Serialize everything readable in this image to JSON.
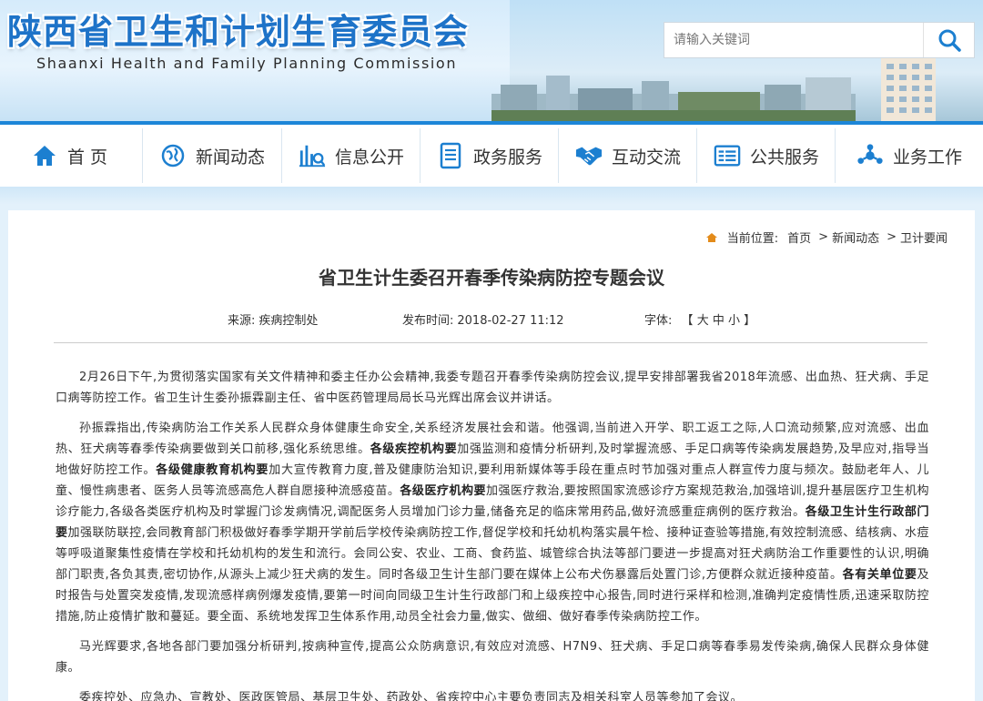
{
  "header": {
    "site_title": "陕西省卫生和计划生育委员会",
    "site_subtitle": "Shaanxi Health and Family Planning Commission",
    "search_placeholder": "请输入关键词"
  },
  "nav": {
    "items": [
      {
        "label": "首 页",
        "icon": "home-icon"
      },
      {
        "label": "新闻动态",
        "icon": "globe-icon"
      },
      {
        "label": "信息公开",
        "icon": "chart-search-icon"
      },
      {
        "label": "政务服务",
        "icon": "document-icon"
      },
      {
        "label": "互动交流",
        "icon": "handshake-icon"
      },
      {
        "label": "公共服务",
        "icon": "list-card-icon"
      },
      {
        "label": "业务工作",
        "icon": "network-icon"
      }
    ],
    "active_color": "#1c86d8"
  },
  "breadcrumb": {
    "lead": "当前位置:",
    "items": [
      "首页",
      "新闻动态",
      "卫计要闻"
    ],
    "separator": ">"
  },
  "article": {
    "title": "省卫生计生委召开春季传染病防控专题会议",
    "source_label": "来源:",
    "source_value": "疾病控制处",
    "date_label": "发布时间:",
    "date_value": "2018-02-27 11:12",
    "font_label": "字体:",
    "font_open": "【",
    "font_large": "大",
    "font_medium": "中",
    "font_small": "小",
    "font_close": "】",
    "paragraphs": [
      [
        {
          "t": "2月26日下午,为贯彻落实国家有关文件精神和委主任办公会精神,我委专题召开春季传染病防控会议,提早安排部署我省2018年流感、出血热、狂犬病、手足口病等防控工作。省卫生计生委孙振霖副主任、省中医药管理局局长马光辉出席会议并讲话。",
          "b": false
        }
      ],
      [
        {
          "t": "孙振霖指出,传染病防治工作关系人民群众身体健康生命安全,关系经济发展社会和谐。他强调,当前进入开学、职工返工之际,人口流动频繁,应对流感、出血热、狂犬病等春季传染病要做到关口前移,强化系统思维。",
          "b": false
        },
        {
          "t": "各级疾控机构要",
          "b": true
        },
        {
          "t": "加强监测和疫情分析研判,及时掌握流感、手足口病等传染病发展趋势,及早应对,指导当地做好防控工作。",
          "b": false
        },
        {
          "t": "各级健康教育机构要",
          "b": true
        },
        {
          "t": "加大宣传教育力度,普及健康防治知识,要利用新媒体等手段在重点时节加强对重点人群宣传力度与频次。鼓励老年人、儿童、慢性病患者、医务人员等流感高危人群自愿接种流感疫苗。",
          "b": false
        },
        {
          "t": "各级医疗机构要",
          "b": true
        },
        {
          "t": "加强医疗救治,要按照国家流感诊疗方案规范救治,加强培训,提升基层医疗卫生机构诊疗能力,各级各类医疗机构及时掌握门诊发病情况,调配医务人员增加门诊力量,储备充足的临床常用药品,做好流感重症病例的医疗救治。",
          "b": false
        },
        {
          "t": "各级卫生计生行政部门要",
          "b": true
        },
        {
          "t": "加强联防联控,会同教育部门积极做好春季学期开学前后学校传染病防控工作,督促学校和托幼机构落实晨午检、接种证查验等措施,有效控制流感、结核病、水痘等呼吸道聚集性疫情在学校和托幼机构的发生和流行。会同公安、农业、工商、食药监、城管综合执法等部门要进一步提高对狂犬病防治工作重要性的认识,明确部门职责,各负其责,密切协作,从源头上减少狂犬病的发生。同时各级卫生计生部门要在媒体上公布犬伤暴露后处置门诊,方便群众就近接种疫苗。",
          "b": false
        },
        {
          "t": "各有关单位要",
          "b": true
        },
        {
          "t": "及时报告与处置突发疫情,发现流感样病例爆发疫情,要第一时间向同级卫生计生行政部门和上级疾控中心报告,同时进行采样和检测,准确判定疫情性质,迅速采取防控措施,防止疫情扩散和蔓延。要全面、系统地发挥卫生体系作用,动员全社会力量,做实、做细、做好春季传染病防控工作。",
          "b": false
        }
      ],
      [
        {
          "t": "马光辉要求,各地各部门要加强分析研判,按病种宣传,提高公众防病意识,有效应对流感、H7N9、狂犬病、手足口病等春季易发传染病,确保人民群众身体健康。",
          "b": false
        }
      ],
      [
        {
          "t": "委疾控处、应急办、宣教处、医政医管局、基层卫生处、药政处、省疾控中心主要负责同志及相关科室人员等参加了会议。",
          "b": false
        }
      ]
    ]
  },
  "colors": {
    "brand_blue": "#1e73c8",
    "nav_icon_blue": "#1c7fd0",
    "breadcrumb_icon": "#e38b1a"
  }
}
